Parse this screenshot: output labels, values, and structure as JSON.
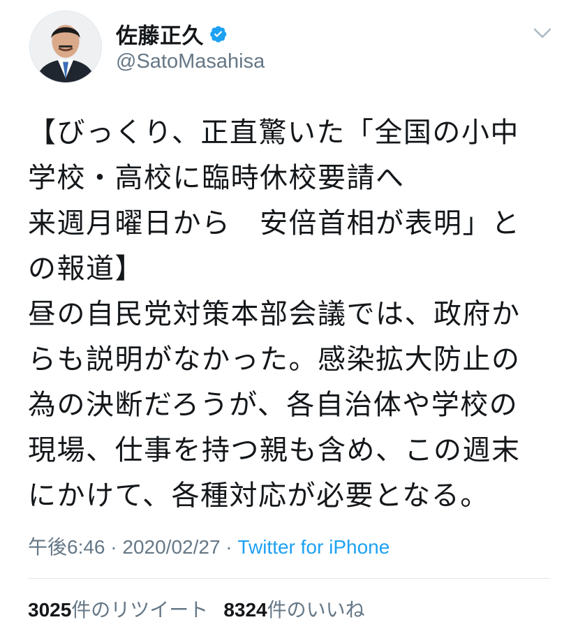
{
  "author": {
    "display_name": "佐藤正久",
    "handle": "@SatoMasahisa"
  },
  "tweet": {
    "lines": [
      "【びっくり、正直驚いた「全国の小中",
      "学校・高校に臨時休校要請へ",
      "来週月曜日から　安倍首相が表明」と",
      "の報道】",
      "昼の自民党対策本部会議では、政府か",
      "らも説明がなかった。感染拡大防止の",
      "為の決断だろうが、各自治体や学校の",
      "現場、仕事を持つ親も含め、この週末",
      "にかけて、各種対応が必要となる。"
    ]
  },
  "meta": {
    "time": "午後6:46",
    "sep1": " · ",
    "date": "2020/02/27",
    "sep2": " · ",
    "source": "Twitter for iPhone"
  },
  "stats": {
    "retweets_count": "3025",
    "retweets_label": "件のリツイート",
    "likes_count": "8324",
    "likes_label": "件のいいね"
  },
  "colors": {
    "text": "#14171a",
    "secondary": "#657786",
    "link": "#1da1f2",
    "verified": "#1da1f2",
    "divider": "#e1e8ed"
  },
  "icons": {
    "verified": "verified-badge-icon",
    "more": "chevron-down-icon"
  }
}
